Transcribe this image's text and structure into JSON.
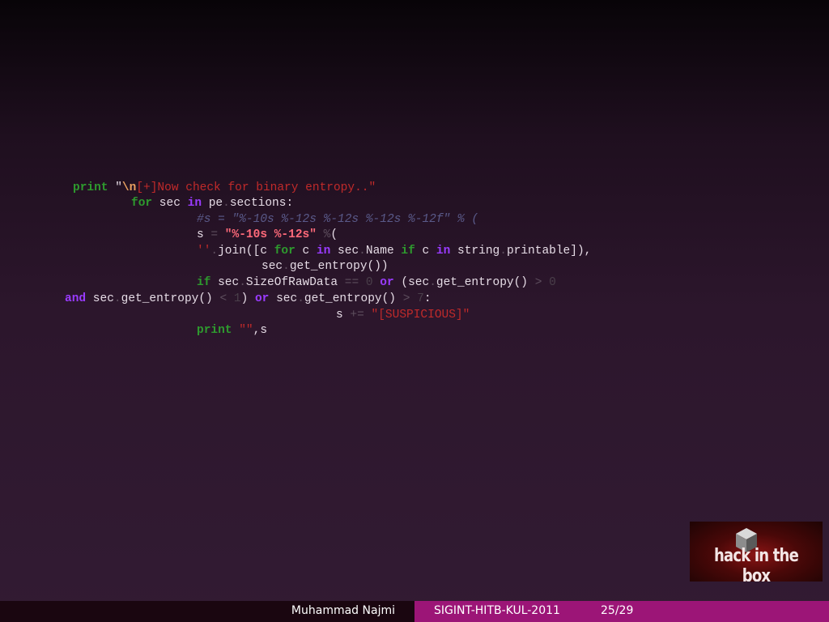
{
  "code_lines": [
    [
      {
        "t": "print",
        "c": "kw-g"
      },
      {
        "t": " \""
      },
      {
        "t": "\\n",
        "c": "esc"
      },
      {
        "t": "[+]Now check for binary entropy..\"",
        "c": "str"
      }
    ],
    [
      {
        "t": "for",
        "c": "kw-g"
      },
      {
        "t": " sec "
      },
      {
        "t": "in",
        "c": "kw-p"
      },
      {
        "t": " pe"
      },
      {
        "t": ".",
        "c": "op"
      },
      {
        "t": "sections:"
      }
    ],
    [
      {
        "t": "#s = \"%-10s %-12s %-12s %-12s %-12f\" % (",
        "c": "cm"
      }
    ],
    [
      {
        "t": "s "
      },
      {
        "t": "=",
        "c": "op"
      },
      {
        "t": " \"%-10s %-12s\"",
        "c": "strb"
      },
      {
        "t": " %",
        "c": "op"
      },
      {
        "t": "("
      }
    ],
    [
      {
        "t": "''",
        "c": "str"
      },
      {
        "t": ".",
        "c": "op"
      },
      {
        "t": "join([c "
      },
      {
        "t": "for",
        "c": "kw-g"
      },
      {
        "t": " c "
      },
      {
        "t": "in",
        "c": "kw-p"
      },
      {
        "t": " sec"
      },
      {
        "t": ".",
        "c": "op"
      },
      {
        "t": "Name "
      },
      {
        "t": "if",
        "c": "kw-g"
      },
      {
        "t": " c "
      },
      {
        "t": "in",
        "c": "kw-p"
      },
      {
        "t": " string"
      },
      {
        "t": ".",
        "c": "op"
      },
      {
        "t": "printable]),"
      }
    ],
    [
      {
        "t": "sec"
      },
      {
        "t": ".",
        "c": "op"
      },
      {
        "t": "get_entropy())"
      }
    ],
    [
      {
        "t": "if",
        "c": "kw-g"
      },
      {
        "t": " sec"
      },
      {
        "t": ".",
        "c": "op"
      },
      {
        "t": "SizeOfRawData "
      },
      {
        "t": "==",
        "c": "op"
      },
      {
        "t": " "
      },
      {
        "t": "0",
        "c": "num"
      },
      {
        "t": " "
      },
      {
        "t": "or",
        "c": "kw-p"
      },
      {
        "t": " (sec"
      },
      {
        "t": ".",
        "c": "op"
      },
      {
        "t": "get_entropy() "
      },
      {
        "t": ">",
        "c": "op"
      },
      {
        "t": " "
      },
      {
        "t": "0",
        "c": "num"
      }
    ],
    [
      {
        "t": "and",
        "c": "kw-p"
      },
      {
        "t": " sec"
      },
      {
        "t": ".",
        "c": "op"
      },
      {
        "t": "get_entropy() "
      },
      {
        "t": "<",
        "c": "op"
      },
      {
        "t": " "
      },
      {
        "t": "1",
        "c": "num"
      },
      {
        "t": ") "
      },
      {
        "t": "or",
        "c": "kw-p"
      },
      {
        "t": " sec"
      },
      {
        "t": ".",
        "c": "op"
      },
      {
        "t": "get_entropy() "
      },
      {
        "t": ">",
        "c": "op"
      },
      {
        "t": " "
      },
      {
        "t": "7",
        "c": "num"
      },
      {
        "t": ":"
      }
    ],
    [
      {
        "t": "s "
      },
      {
        "t": "+=",
        "c": "op"
      },
      {
        "t": " "
      },
      {
        "t": "\"[SUSPICIOUS]\"",
        "c": "str"
      }
    ],
    [
      {
        "t": "print",
        "c": "kw-g"
      },
      {
        "t": " "
      },
      {
        "t": "\"\"",
        "c": "str"
      },
      {
        "t": ",s"
      }
    ]
  ],
  "logo": {
    "text": "hack in the box",
    "icon": "cube-icon"
  },
  "footer": {
    "author": "Muhammad Najmi",
    "title": "SIGINT-HITB-KUL-2011",
    "page": "25/29"
  },
  "colors": {
    "keyword_green": "#2e9a2e",
    "keyword_purple": "#9a3bff",
    "string_red": "#c02a2a",
    "footer_accent": "#9c1577"
  }
}
